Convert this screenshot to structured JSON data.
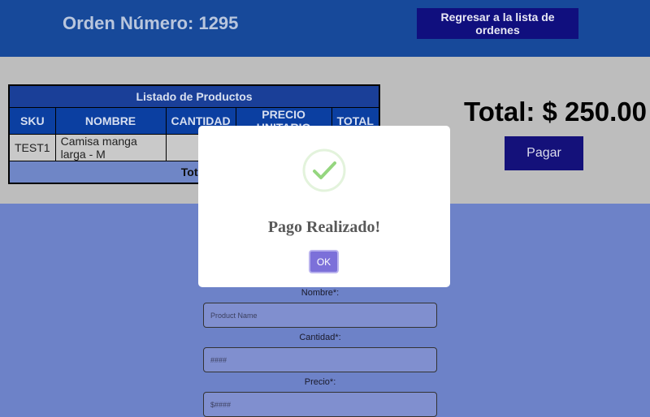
{
  "header": {
    "order_title": "Orden Número: 1295",
    "back_button": "Regresar a la lista de ordenes"
  },
  "products_table": {
    "caption": "Listado de Productos",
    "columns": [
      "SKU",
      "NOMBRE",
      "CANTIDAD",
      "PRECIO UNITARIO",
      "TOTAL"
    ],
    "rows": [
      {
        "sku": "TEST1",
        "name": "Camisa manga larga - M",
        "qty": "",
        "unit_price": "",
        "total": ""
      }
    ],
    "total_label": "Total"
  },
  "summary": {
    "total_text": "Total: $ 250.00",
    "pay_button": "Pagar"
  },
  "form": {
    "name_label": "Nombre*:",
    "name_placeholder": "Product Name",
    "qty_label": "Cantidad*:",
    "qty_placeholder": "####",
    "price_label": "Precio*:",
    "price_placeholder": "$####"
  },
  "modal": {
    "icon": "success-check-icon",
    "title": "Pago Realizado!",
    "ok_button": "OK"
  },
  "colors": {
    "header_bg": "#17499a",
    "accent_button": "#100f7e",
    "success_green": "#9bd98a",
    "ok_button": "#7c70d9"
  }
}
